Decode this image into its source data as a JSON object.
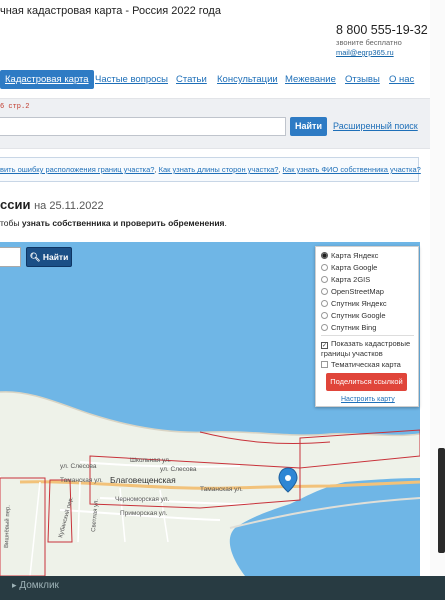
{
  "header": {
    "title": "чная кадастровая карта - Россия 2022 года",
    "phone": "8 800 555-19-32",
    "phone_note": "звоните бесплатно",
    "email": "mail@egrp365.ru"
  },
  "nav": {
    "items": [
      {
        "label": "Кадастровая карта",
        "active": true
      },
      {
        "label": "Частые вопросы",
        "active": false
      },
      {
        "label": "Статьи",
        "active": false
      },
      {
        "label": "Консультации",
        "active": false
      },
      {
        "label": "Межевание",
        "active": false
      },
      {
        "label": "Отзывы",
        "active": false
      },
      {
        "label": "О нас",
        "active": false
      }
    ]
  },
  "search": {
    "breadcrumb": "6 стр.2",
    "value": "",
    "button_label": "Найти",
    "advanced_label": "Расширенный поиск"
  },
  "faq": {
    "links": [
      "вить ошибку расположения границ участка?",
      "Как узнать длины сторон участка?",
      "Как узнать ФИО собственника участка?"
    ],
    "separator": ", "
  },
  "page": {
    "heading": "ссии",
    "date": "на 25.11.2022",
    "subtitle_prefix": "тобы ",
    "subtitle_bold": "узнать собственника и проверить обременения",
    "subtitle_suffix": "."
  },
  "map": {
    "search_button": "Найти",
    "search_icon": "search-icon",
    "layers": [
      {
        "label": "Карта Яндекс",
        "selected": true
      },
      {
        "label": "Карта Google",
        "selected": false
      },
      {
        "label": "Карта 2GIS",
        "selected": false
      },
      {
        "label": "OpenStreetMap",
        "selected": false
      },
      {
        "label": "Спутник Яндекс",
        "selected": false
      },
      {
        "label": "Спутник Google",
        "selected": false
      },
      {
        "label": "Спутник Bing",
        "selected": false
      }
    ],
    "options": [
      {
        "label": "Показать кадастровые границы участков",
        "checked": true
      },
      {
        "label": "Тематическая карта",
        "checked": false
      }
    ],
    "share_label": "Поделиться ссылкой",
    "setup_label": "Настроить карту",
    "place_labels": {
      "town": "Благовещенская",
      "street_1": "Школьная ул.",
      "street_2": "ул. Слесова",
      "street_3": "ул. Слесова",
      "street_4": "Таманская ул.",
      "street_5": "Таманская ул.",
      "street_6": "Черноморская ул.",
      "street_7": "Приморская ул.",
      "street_8": "Светлая ул.",
      "street_9": "Кубанский пер.",
      "street_10": "Вишнёвый пер."
    },
    "colors": {
      "water": "#6fb6e6",
      "land": "#eef2e9",
      "boundary": "#c8323a",
      "marker": "#2e86d4"
    }
  },
  "footer": {
    "brand": "Домклик"
  }
}
